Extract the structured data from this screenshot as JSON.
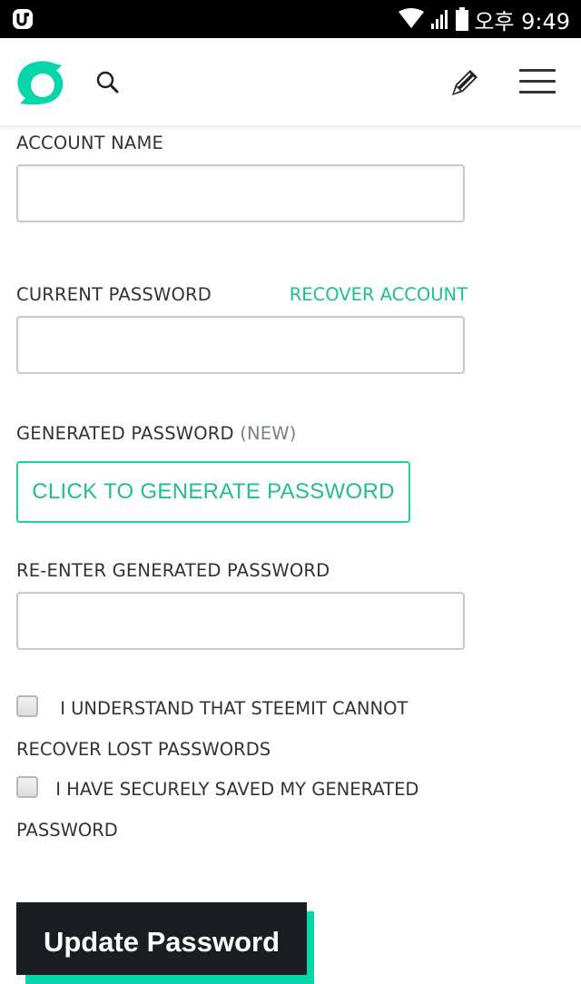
{
  "status_bar": {
    "clock": "오후 9:49",
    "icons": [
      "app-notification-icon",
      "wifi-icon",
      "signal-icon",
      "battery-icon"
    ]
  },
  "header": {
    "logo": "steemit-logo",
    "search_icon": "search-icon",
    "compose_icon": "pencil-icon",
    "menu_icon": "hamburger-menu-icon"
  },
  "form": {
    "account_name": {
      "label": "ACCOUNT NAME",
      "value": "",
      "placeholder": ""
    },
    "current_password": {
      "label": "CURRENT PASSWORD",
      "recover_link": "RECOVER ACCOUNT",
      "value": "",
      "placeholder": ""
    },
    "generated_password": {
      "label": "GENERATED PASSWORD",
      "label_suffix": "(NEW)",
      "button": "CLICK TO GENERATE PASSWORD"
    },
    "reenter_password": {
      "label": "RE-ENTER GENERATED PASSWORD",
      "value": "",
      "placeholder": ""
    },
    "checkboxes": [
      {
        "label_line1": "I UNDERSTAND THAT STEEMIT CANNOT",
        "label_line2": "RECOVER LOST PASSWORDS",
        "checked": false
      },
      {
        "label_line1": "I HAVE SECURELY SAVED MY GENERATED",
        "label_line2": "PASSWORD",
        "checked": false
      }
    ],
    "submit": "Update Password"
  },
  "colors": {
    "accent": "#1fbf8f",
    "accent_border": "#1fd1a1",
    "button_dark": "#1a1e22",
    "button_shadow": "#06d6a9"
  }
}
